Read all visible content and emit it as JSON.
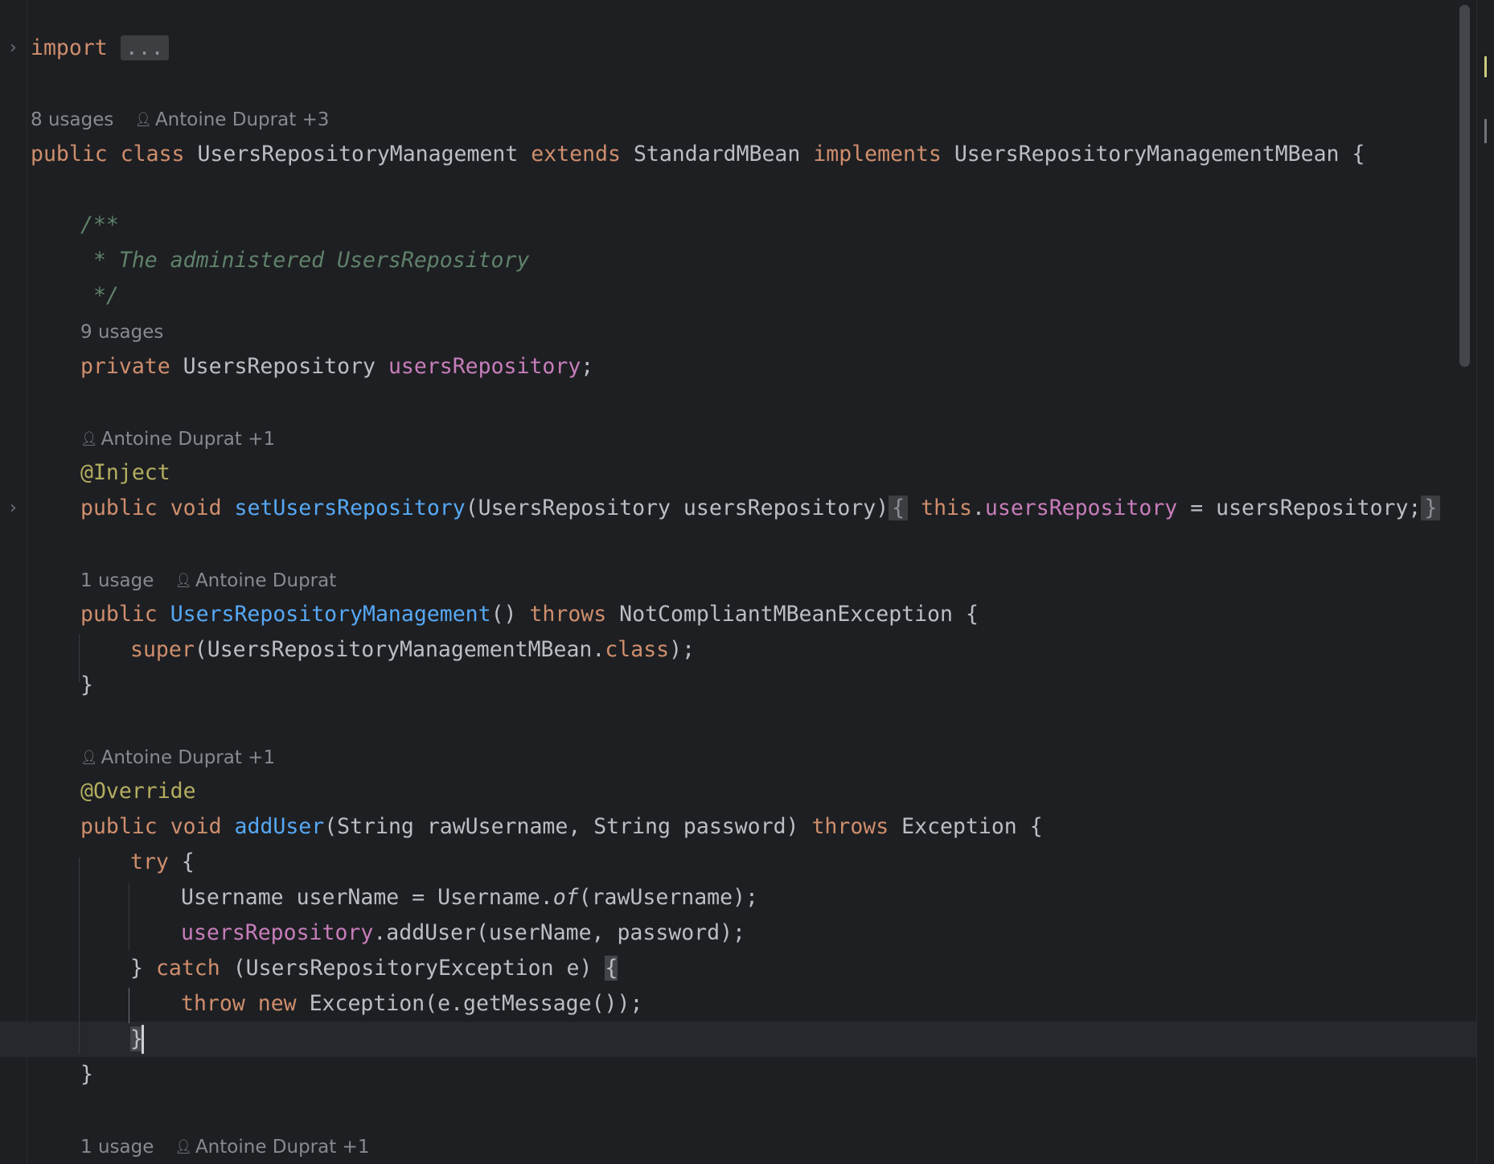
{
  "editor": {
    "import_keyword": "import",
    "import_folded": "...",
    "class_lens": {
      "usages": "8 usages",
      "authors": "Antoine Duprat +3"
    },
    "class_decl": {
      "kw_public": "public",
      "kw_class": "class",
      "name": "UsersRepositoryManagement",
      "kw_extends": "extends",
      "superclass": "StandardMBean",
      "kw_implements": "implements",
      "iface": "UsersRepositoryManagementMBean",
      "brace": "{"
    },
    "javadoc": [
      "/**",
      " * The administered UsersRepository",
      " */"
    ],
    "field_lens": {
      "usages": "9 usages"
    },
    "field_decl": {
      "kw_private": "private",
      "type": "UsersRepository",
      "name": "usersRepository",
      "semi": ";"
    },
    "setter_lens": {
      "authors": "Antoine Duprat +1"
    },
    "setter_annotation": "@Inject",
    "setter_decl": {
      "kw_public": "public",
      "kw_void": "void",
      "name": "setUsersRepository",
      "params": "(UsersRepository usersRepository)",
      "open_brace": "{",
      "kw_this": "this",
      "dot": ".",
      "field": "usersRepository",
      "assign": " = usersRepository;",
      "close_brace": "}"
    },
    "ctor_lens": {
      "usages": "1 usage",
      "authors": "Antoine Duprat"
    },
    "ctor_decl": {
      "kw_public": "public",
      "name": "UsersRepositoryManagement",
      "parens": "()",
      "kw_throws": "throws",
      "exception": "NotCompliantMBeanException",
      "brace": "{"
    },
    "ctor_body": {
      "kw_super": "super",
      "arg": "(UsersRepositoryManagementMBean.",
      "kw_class": "class",
      "end": ");"
    },
    "ctor_close": "}",
    "adduser_lens": {
      "authors": "Antoine Duprat +1"
    },
    "adduser_annotation": "@Override",
    "adduser_decl": {
      "kw_public": "public",
      "kw_void": "void",
      "name": "addUser",
      "params": "(String rawUsername, String password)",
      "kw_throws": "throws",
      "exception": "Exception",
      "brace": "{"
    },
    "try_line": {
      "kw_try": "try",
      "brace": "{"
    },
    "username_line": {
      "prefix": "Username userName = Username.",
      "method": "of",
      "suffix": "(rawUsername);"
    },
    "adduser_call": {
      "field": "usersRepository",
      "rest": ".addUser(userName, password);"
    },
    "catch_line": {
      "close": "}",
      "kw_catch": "catch",
      "params": "(UsersRepositoryException e)",
      "brace": "{"
    },
    "throw_line": {
      "kw_throw": "throw",
      "kw_new": "new",
      "rest": "Exception(e.getMessage());"
    },
    "catch_close": "}",
    "method_close": "}",
    "next_lens": {
      "usages": "1 usage",
      "authors": "Antoine Duprat +1"
    }
  },
  "colors": {
    "background": "#1e1f22",
    "keyword": "#cf8e6d",
    "function": "#56a8f5",
    "field": "#c77dbb",
    "annotation": "#b3ae60",
    "comment": "#5f826b",
    "text": "#bcbec4"
  },
  "icons": {
    "fold": "chevron-right-icon",
    "author": "person-icon"
  }
}
